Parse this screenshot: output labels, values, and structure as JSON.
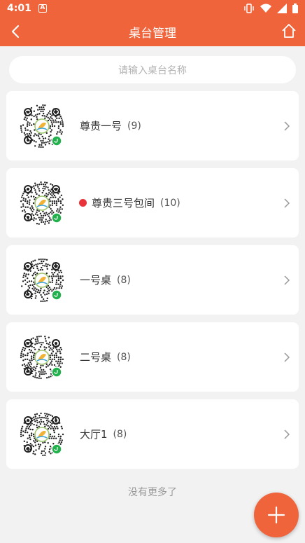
{
  "status_bar": {
    "time": "4:01",
    "notification_icon": "a-icon",
    "icons": [
      "vibrate-icon",
      "wifi-icon",
      "signal-icon",
      "battery-icon"
    ]
  },
  "header": {
    "title": "桌台管理",
    "background": "#f0643c"
  },
  "search": {
    "placeholder": "请输入桌台名称"
  },
  "tables": [
    {
      "name": "尊贵一号",
      "count": "(9)",
      "status_dot": false
    },
    {
      "name": "尊贵三号包间",
      "count": "(10)",
      "status_dot": true,
      "dot_color": "#e8333a"
    },
    {
      "name": "一号桌",
      "count": "(8)",
      "status_dot": false
    },
    {
      "name": "二号桌",
      "count": "(8)",
      "status_dot": false
    },
    {
      "name": "大厅1",
      "count": "(8)",
      "status_dot": false
    }
  ],
  "footer": {
    "no_more_text": "没有更多了"
  },
  "fab": {
    "icon": "plus-icon"
  }
}
